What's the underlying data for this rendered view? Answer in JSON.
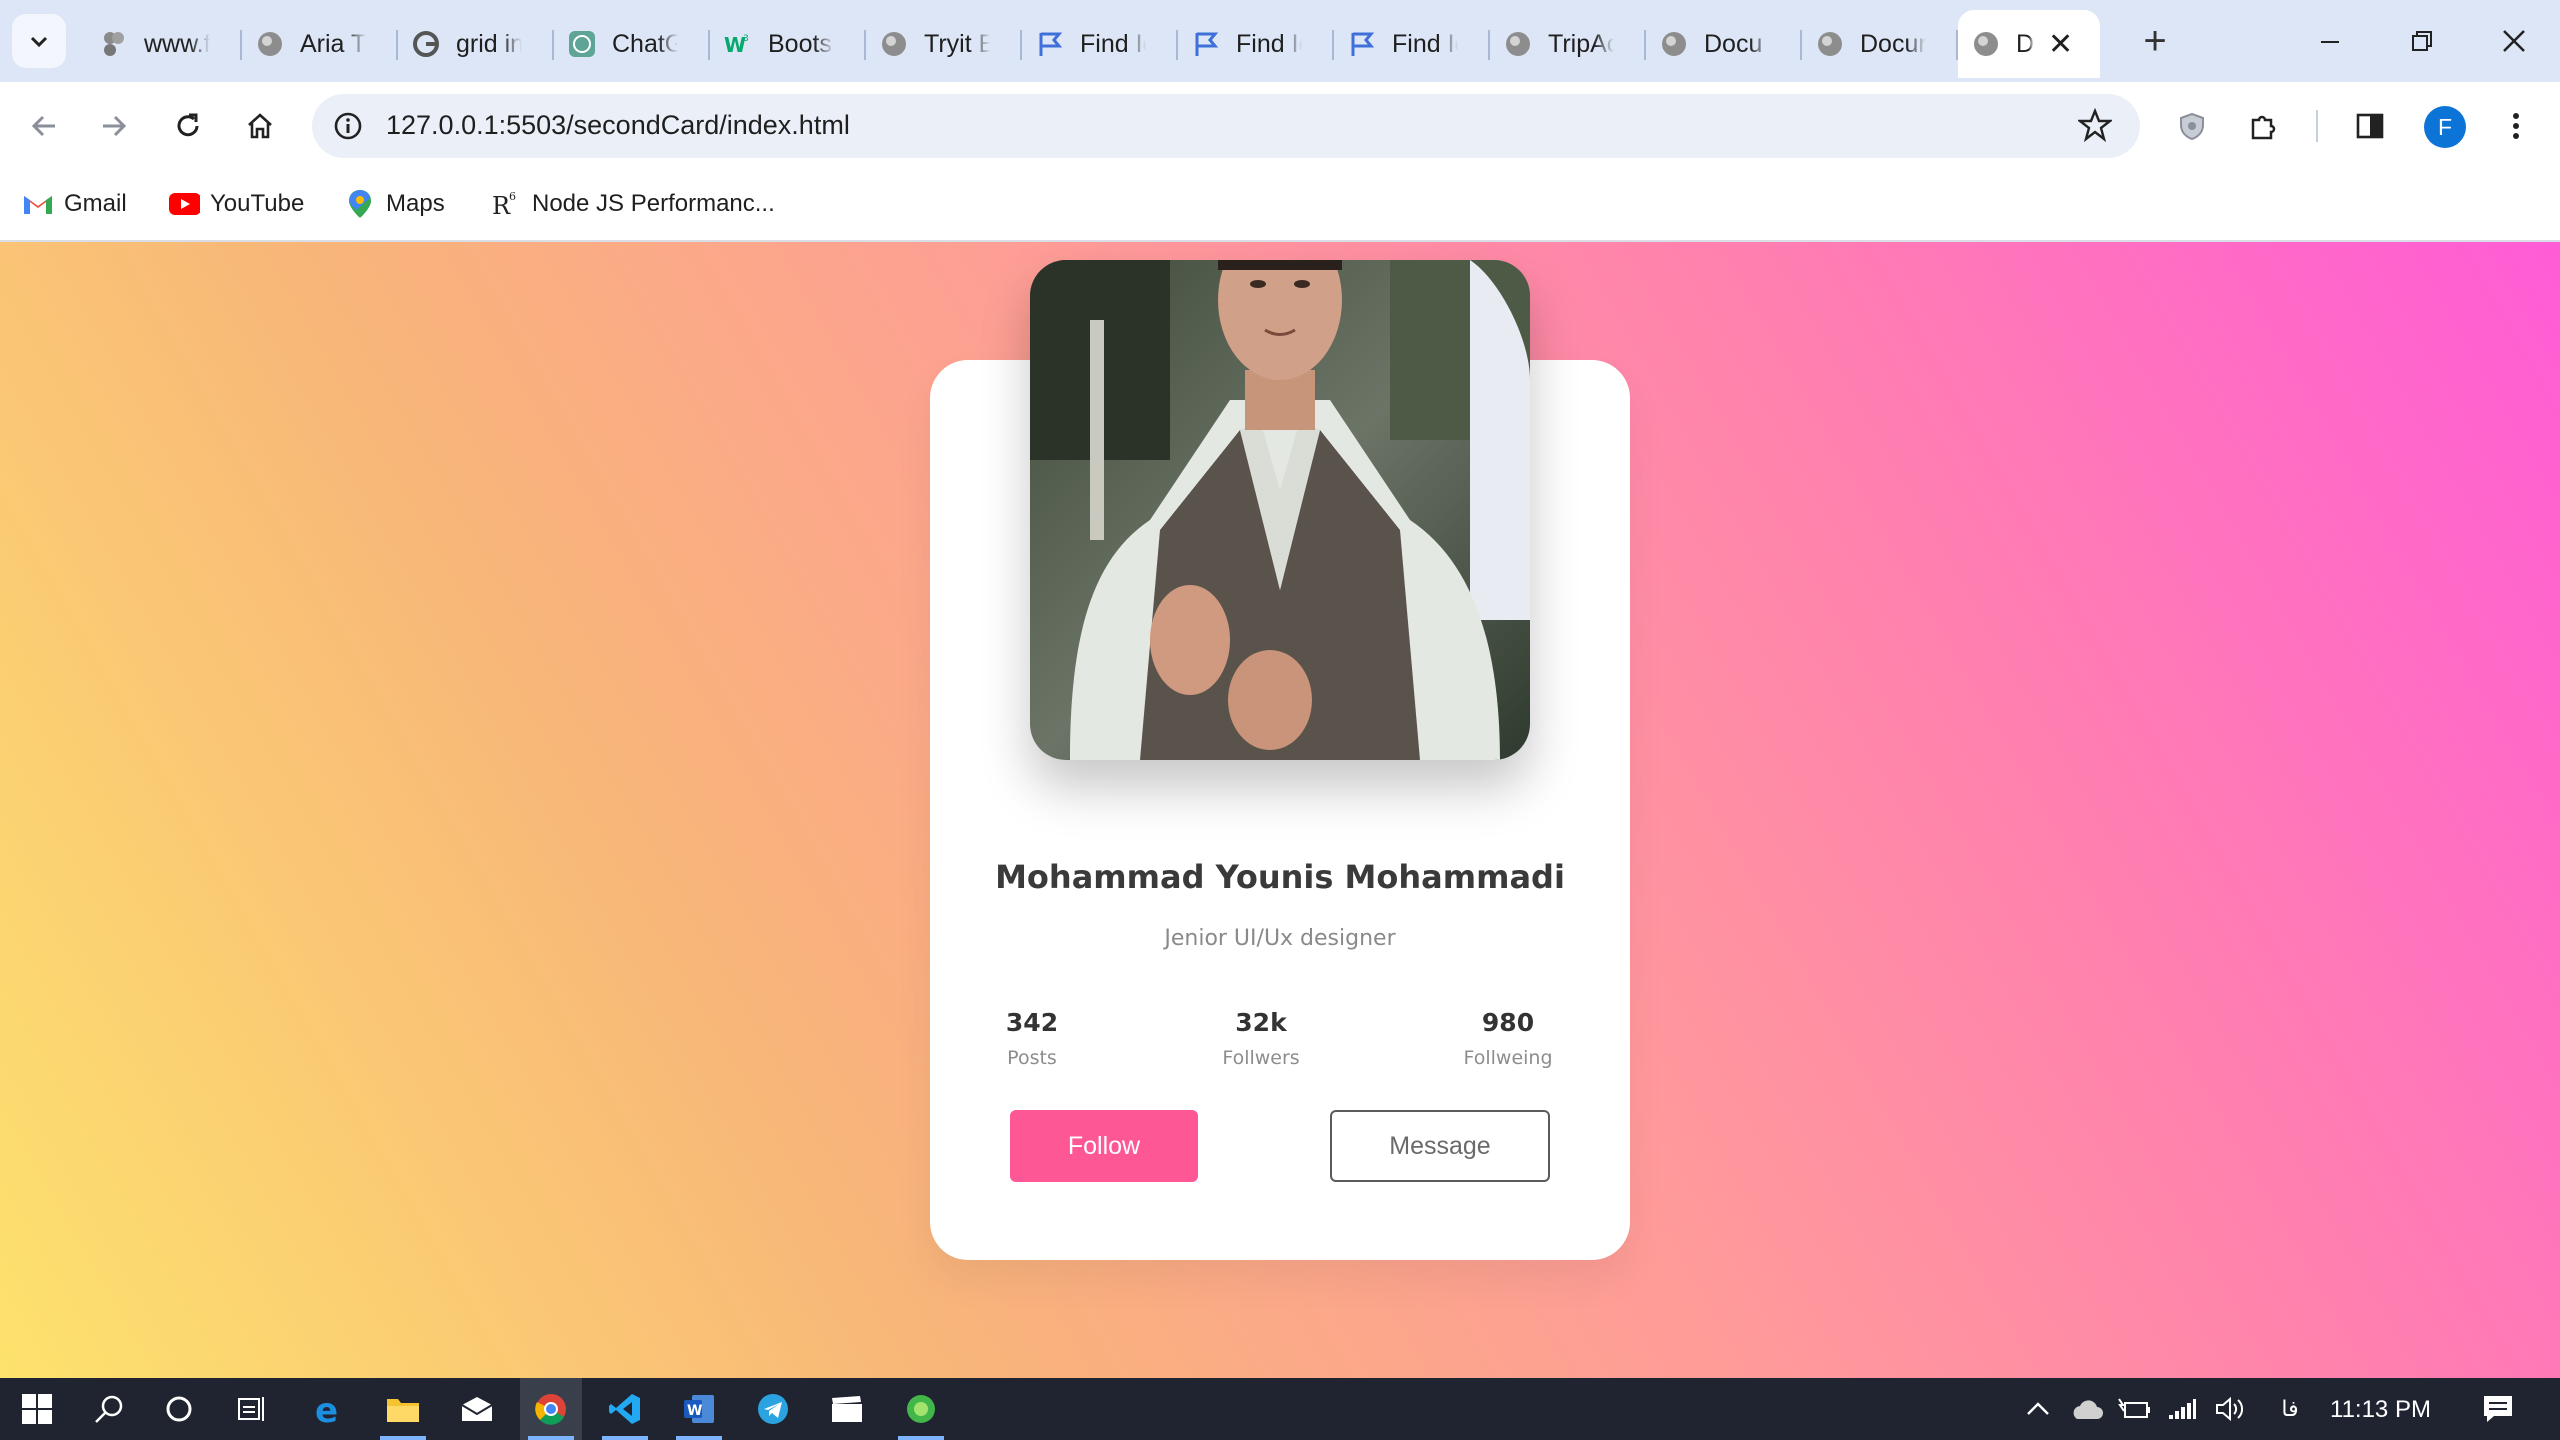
{
  "browser": {
    "tabs": [
      {
        "title": "www.f",
        "icon": "figma-icon"
      },
      {
        "title": "Aria Ti",
        "icon": "globe-icon"
      },
      {
        "title": "grid in",
        "icon": "google-icon"
      },
      {
        "title": "ChatG",
        "icon": "chatgpt-icon"
      },
      {
        "title": "Boots",
        "icon": "w3schools-icon"
      },
      {
        "title": "Tryit E",
        "icon": "globe-icon"
      },
      {
        "title": "Find Ic",
        "icon": "flag-icon"
      },
      {
        "title": "Find Ic",
        "icon": "flag-icon"
      },
      {
        "title": "Find Ic",
        "icon": "flag-icon"
      },
      {
        "title": "TripAc",
        "icon": "globe-icon"
      },
      {
        "title": "Docu",
        "icon": "globe-icon"
      },
      {
        "title": "Docur",
        "icon": "globe-icon"
      }
    ],
    "active_tab": {
      "title": "D",
      "icon": "globe-icon"
    },
    "url": "127.0.0.1:5503/secondCard/index.html",
    "profile_initial": "F",
    "bookmarks": [
      {
        "label": "Gmail",
        "icon": "gmail-icon"
      },
      {
        "label": "YouTube",
        "icon": "youtube-icon"
      },
      {
        "label": "Maps",
        "icon": "maps-icon"
      },
      {
        "label": "Node JS Performanc...",
        "icon": "r6-icon"
      }
    ]
  },
  "card": {
    "name": "Mohammad Younis Mohammadi",
    "role": "Jenior UI/Ux designer",
    "stats": [
      {
        "value": "342",
        "label": "Posts"
      },
      {
        "value": "32k",
        "label": "Follwers"
      },
      {
        "value": "980",
        "label": "Follweing"
      }
    ],
    "follow_label": "Follow",
    "message_label": "Message"
  },
  "taskbar": {
    "time": "11:13 PM",
    "lang": "فا"
  },
  "colors": {
    "follow_button": "#fd5796",
    "gradient_left": "#fde26d",
    "gradient_right": "#ff5cd6"
  }
}
